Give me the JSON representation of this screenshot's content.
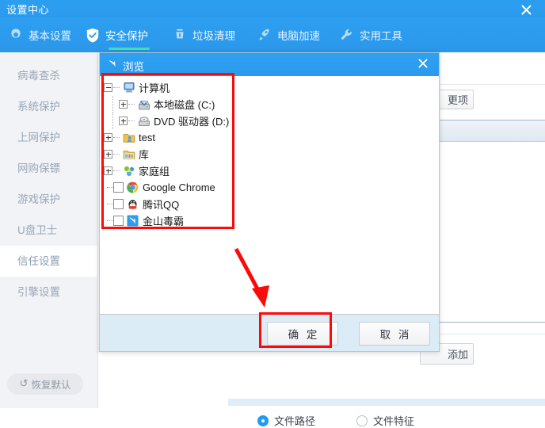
{
  "window": {
    "title": "设置中心",
    "close_icon": "close-icon"
  },
  "nav": {
    "items": [
      {
        "label": "基本设置",
        "icon": "gear-icon",
        "active": false
      },
      {
        "label": "安全保护",
        "icon": "shield-icon",
        "active": true
      },
      {
        "label": "垃圾清理",
        "icon": "broom-icon",
        "active": false
      },
      {
        "label": "电脑加速",
        "icon": "rocket-icon",
        "active": false
      },
      {
        "label": "实用工具",
        "icon": "wrench-icon",
        "active": false
      }
    ],
    "active_underline_color": "#3fe0b4"
  },
  "sidebar": {
    "items": [
      {
        "label": "病毒查杀",
        "active": false
      },
      {
        "label": "系统保护",
        "active": false
      },
      {
        "label": "上网保护",
        "active": false
      },
      {
        "label": "网购保镖",
        "active": false
      },
      {
        "label": "游戏保护",
        "active": false
      },
      {
        "label": "U盘卫士",
        "active": false
      },
      {
        "label": "信任设置",
        "active": true
      },
      {
        "label": "引擎设置",
        "active": false
      }
    ],
    "restore_button": {
      "label": "恢复默认",
      "icon": "refresh-icon",
      "glyph": "↺"
    }
  },
  "background_panel": {
    "options_button_label": "更项",
    "add_button_label": "添加",
    "list_header_label": "",
    "radio_options": [
      {
        "label": "文件路径",
        "checked": true
      },
      {
        "label": "文件特征",
        "checked": false
      }
    ]
  },
  "dialog": {
    "title": "浏览",
    "title_icon": "kingsoft-antivirus-icon",
    "close_icon": "close-icon",
    "ok_button": "确 定",
    "cancel_button": "取 消",
    "tree": [
      {
        "id": "computer",
        "label": "计算机",
        "depth": 0,
        "control": "minus",
        "icon": "computer-icon"
      },
      {
        "id": "c-drive",
        "label": "本地磁盘 (C:)",
        "depth": 1,
        "control": "plus",
        "icon": "harddisk-icon"
      },
      {
        "id": "d-drive",
        "label": "DVD 驱动器 (D:)",
        "depth": 1,
        "control": "plus",
        "icon": "dvd-drive-icon"
      },
      {
        "id": "test",
        "label": "test",
        "depth": 0,
        "control": "plus",
        "icon": "user-folder-icon"
      },
      {
        "id": "library",
        "label": "库",
        "depth": 0,
        "control": "plus",
        "icon": "library-icon"
      },
      {
        "id": "homegroup",
        "label": "家庭组",
        "depth": 0,
        "control": "plus",
        "icon": "homegroup-icon"
      },
      {
        "id": "chrome",
        "label": "Google Chrome",
        "depth": 0,
        "control": "checkbox",
        "icon": "chrome-icon",
        "checked": false
      },
      {
        "id": "qq",
        "label": "腾讯QQ",
        "depth": 0,
        "control": "checkbox",
        "icon": "qq-penguin-icon",
        "checked": false
      },
      {
        "id": "duba",
        "label": "金山毒霸",
        "depth": 0,
        "control": "checkbox",
        "icon": "kingsoft-antivirus-icon",
        "checked": false
      }
    ]
  },
  "annotations": {
    "highlight_color": "#fb0a0a",
    "arrow_icon": "red-arrow-icon",
    "tree_highlight": "tree-region",
    "ok_highlight": "ok-button-region"
  }
}
